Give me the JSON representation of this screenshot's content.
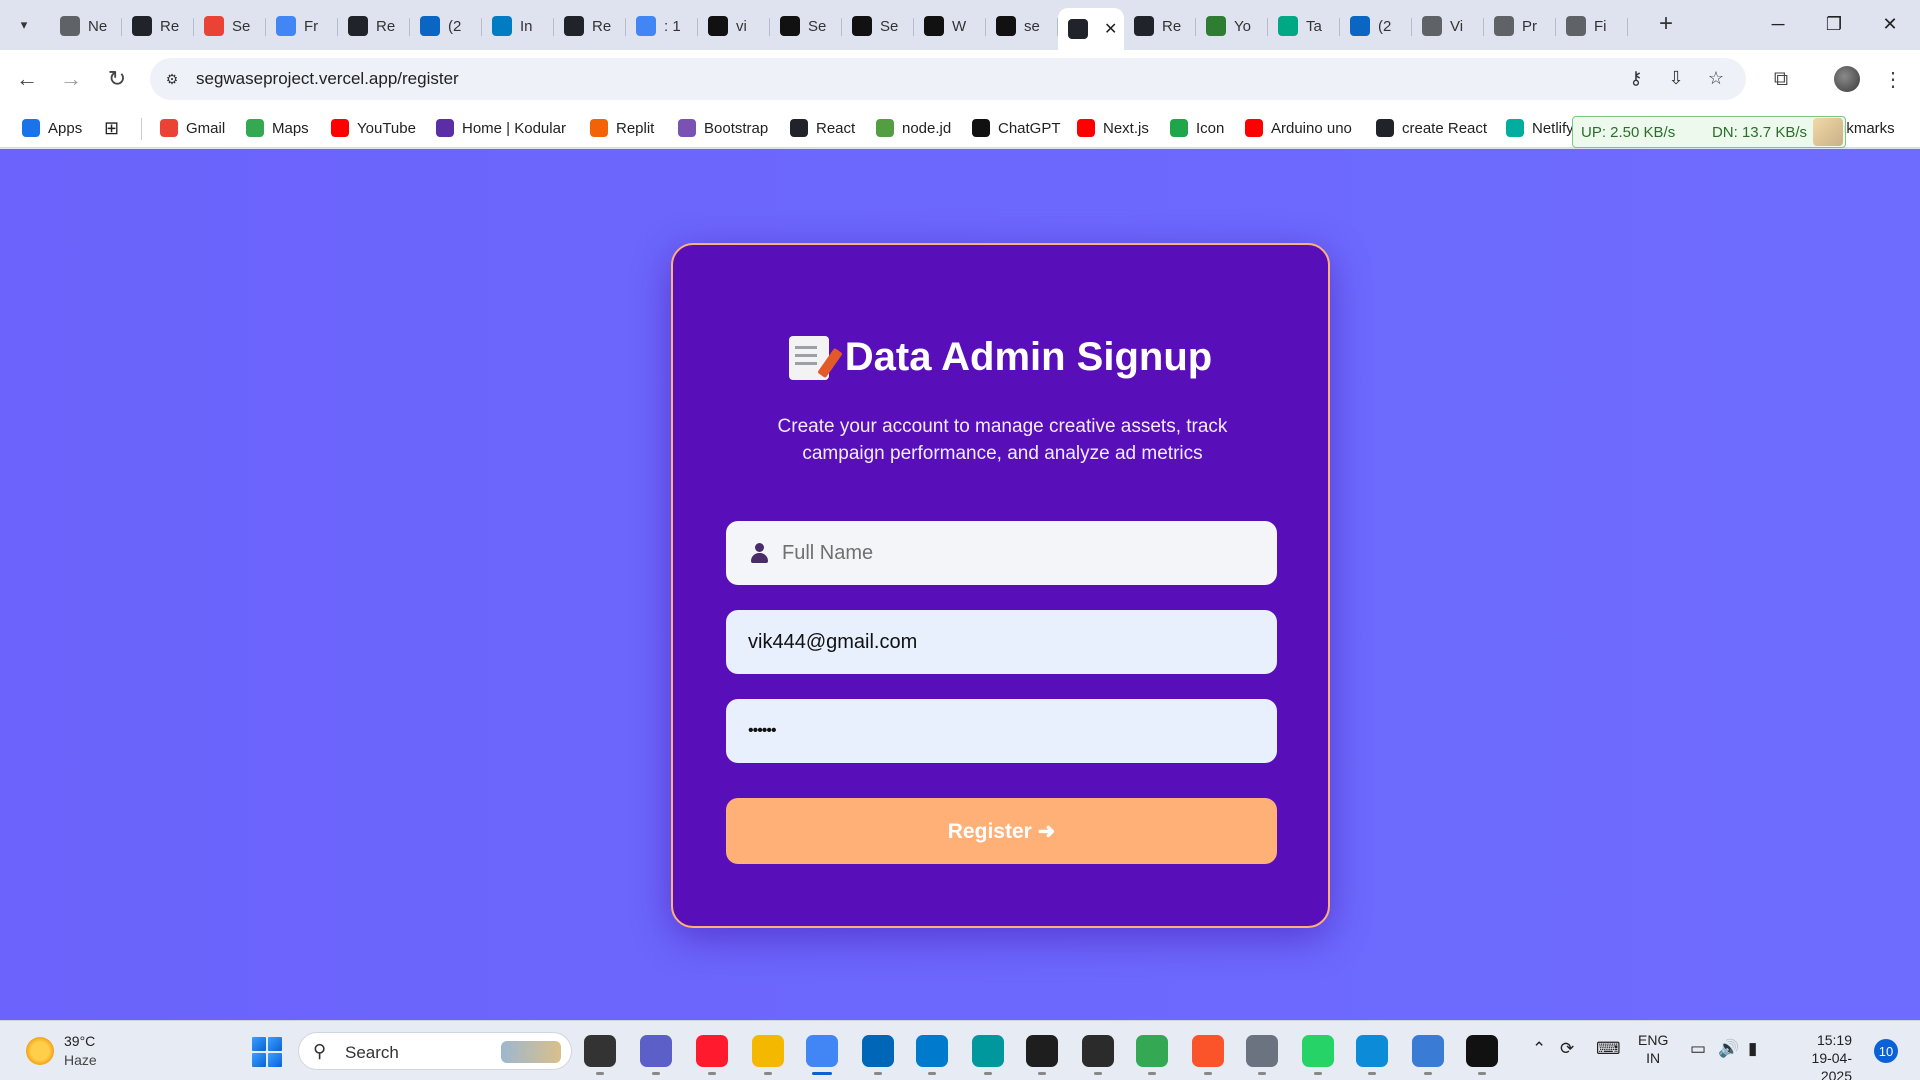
{
  "browser": {
    "tabs": [
      {
        "label": "Ne",
        "icon": "chrome-icon",
        "color": "#5f6368"
      },
      {
        "label": "Re",
        "icon": "react-icon",
        "color": "#20232a"
      },
      {
        "label": "Se",
        "icon": "gmail-icon",
        "color": "#ea4335"
      },
      {
        "label": "Fr",
        "icon": "docs-icon",
        "color": "#4285f4"
      },
      {
        "label": "Re",
        "icon": "react-icon",
        "color": "#20232a"
      },
      {
        "label": "(2",
        "icon": "linkedin-icon",
        "color": "#0a66c2"
      },
      {
        "label": "In",
        "icon": "infosys-icon",
        "color": "#007cc3"
      },
      {
        "label": "Re",
        "icon": "react-icon",
        "color": "#20232a"
      },
      {
        "label": ": 1",
        "icon": "google-icon",
        "color": "#4285f4"
      },
      {
        "label": "vi",
        "icon": "github-icon",
        "color": "#111111"
      },
      {
        "label": "Se",
        "icon": "vercel-icon",
        "color": "#111111"
      },
      {
        "label": "Se",
        "icon": "github-icon",
        "color": "#111111"
      },
      {
        "label": "W",
        "icon": "openai-icon",
        "color": "#111111"
      },
      {
        "label": "se",
        "icon": "vercel-icon",
        "color": "#111111"
      },
      {
        "label": "",
        "icon": "react-icon",
        "color": "#20232a",
        "active": true
      },
      {
        "label": "Re",
        "icon": "react-icon",
        "color": "#20232a"
      },
      {
        "label": "Yo",
        "icon": "leaf-icon",
        "color": "#2e7d32"
      },
      {
        "label": "Ta",
        "icon": "s-icon",
        "color": "#00a884"
      },
      {
        "label": "(2",
        "icon": "linkedin-icon",
        "color": "#0a66c2"
      },
      {
        "label": "Vi",
        "icon": "globe-icon",
        "color": "#5f6368"
      },
      {
        "label": "Pr",
        "icon": "globe-icon",
        "color": "#5f6368"
      },
      {
        "label": "Fi",
        "icon": "globe-icon",
        "color": "#5f6368"
      }
    ],
    "url": "segwaseproject.vercel.app/register",
    "bookmarks": [
      {
        "label": "Apps",
        "icon": "apps-grid-icon",
        "color": "#1a73e8"
      },
      {
        "label": "Gmail",
        "icon": "gmail-icon",
        "color": "#ea4335"
      },
      {
        "label": "Maps",
        "icon": "maps-pin-icon",
        "color": "#34a853"
      },
      {
        "label": "YouTube",
        "icon": "youtube-icon",
        "color": "#ff0000"
      },
      {
        "label": "Home | Kodular",
        "icon": "kodular-icon",
        "color": "#5b2ea6"
      },
      {
        "label": "Replit",
        "icon": "replit-icon",
        "color": "#f26207"
      },
      {
        "label": "Bootstrap",
        "icon": "bootstrap-icon",
        "color": "#7952b3"
      },
      {
        "label": "React",
        "icon": "react-icon",
        "color": "#20232a"
      },
      {
        "label": "node.jd",
        "icon": "nodejs-icon",
        "color": "#539e43"
      },
      {
        "label": "ChatGPT",
        "icon": "openai-icon",
        "color": "#111111"
      },
      {
        "label": "Next.js",
        "icon": "youtube-icon",
        "color": "#ff0000"
      },
      {
        "label": "Icon",
        "icon": "icon-site-icon",
        "color": "#1fa64a"
      },
      {
        "label": "Arduino uno",
        "icon": "youtube-icon",
        "color": "#ff0000"
      },
      {
        "label": "create React",
        "icon": "react-icon",
        "color": "#20232a"
      },
      {
        "label": "Netlify",
        "icon": "netlify-icon",
        "color": "#00ad9f"
      }
    ],
    "bookmarks_overflow": "okmarks",
    "netspeed": {
      "up": "UP: 2.50 KB/s",
      "down": "DN: 13.7 KB/s"
    }
  },
  "signup": {
    "title": "Data Admin Signup",
    "title_icon": "memo-icon",
    "subtitle_line1": "Create your account to manage creative assets, track",
    "subtitle_line2": "campaign performance, and analyze ad metrics",
    "name_placeholder": "Full Name",
    "email_value": "vik444@gmail.com",
    "password_value": "••••••",
    "register_label": "Register ➜"
  },
  "taskbar": {
    "weather_temp": "39°C",
    "weather_condition": "Haze",
    "search_label": "Search",
    "apps": [
      {
        "icon": "task-view-icon",
        "color": "#333333"
      },
      {
        "icon": "meet-icon",
        "color": "#5b5fc7"
      },
      {
        "icon": "opera-icon",
        "color": "#ff1b2d"
      },
      {
        "icon": "file-explorer-icon",
        "color": "#f5b800"
      },
      {
        "icon": "chrome-icon",
        "color": "#4285f4"
      },
      {
        "icon": "store-icon",
        "color": "#0067b8"
      },
      {
        "icon": "vscode-icon",
        "color": "#007acc"
      },
      {
        "icon": "arduino-icon",
        "color": "#00979d"
      },
      {
        "icon": "figma-icon",
        "color": "#1e1e1e"
      },
      {
        "icon": "tool-icon",
        "color": "#2b2b2b"
      },
      {
        "icon": "chrome-canary-icon",
        "color": "#34a853"
      },
      {
        "icon": "brave-icon",
        "color": "#fb542b"
      },
      {
        "icon": "settings-icon",
        "color": "#6b7280"
      },
      {
        "icon": "whatsapp-icon",
        "color": "#25d366"
      },
      {
        "icon": "edge-icon",
        "color": "#0c8cd8"
      },
      {
        "icon": "snipping-icon",
        "color": "#3a7bd5"
      },
      {
        "icon": "chatgpt-icon",
        "color": "#111111"
      }
    ],
    "lang_line1": "ENG",
    "lang_line2": "IN",
    "time": "15:19",
    "date": "19-04-2025",
    "notifications": "10"
  }
}
